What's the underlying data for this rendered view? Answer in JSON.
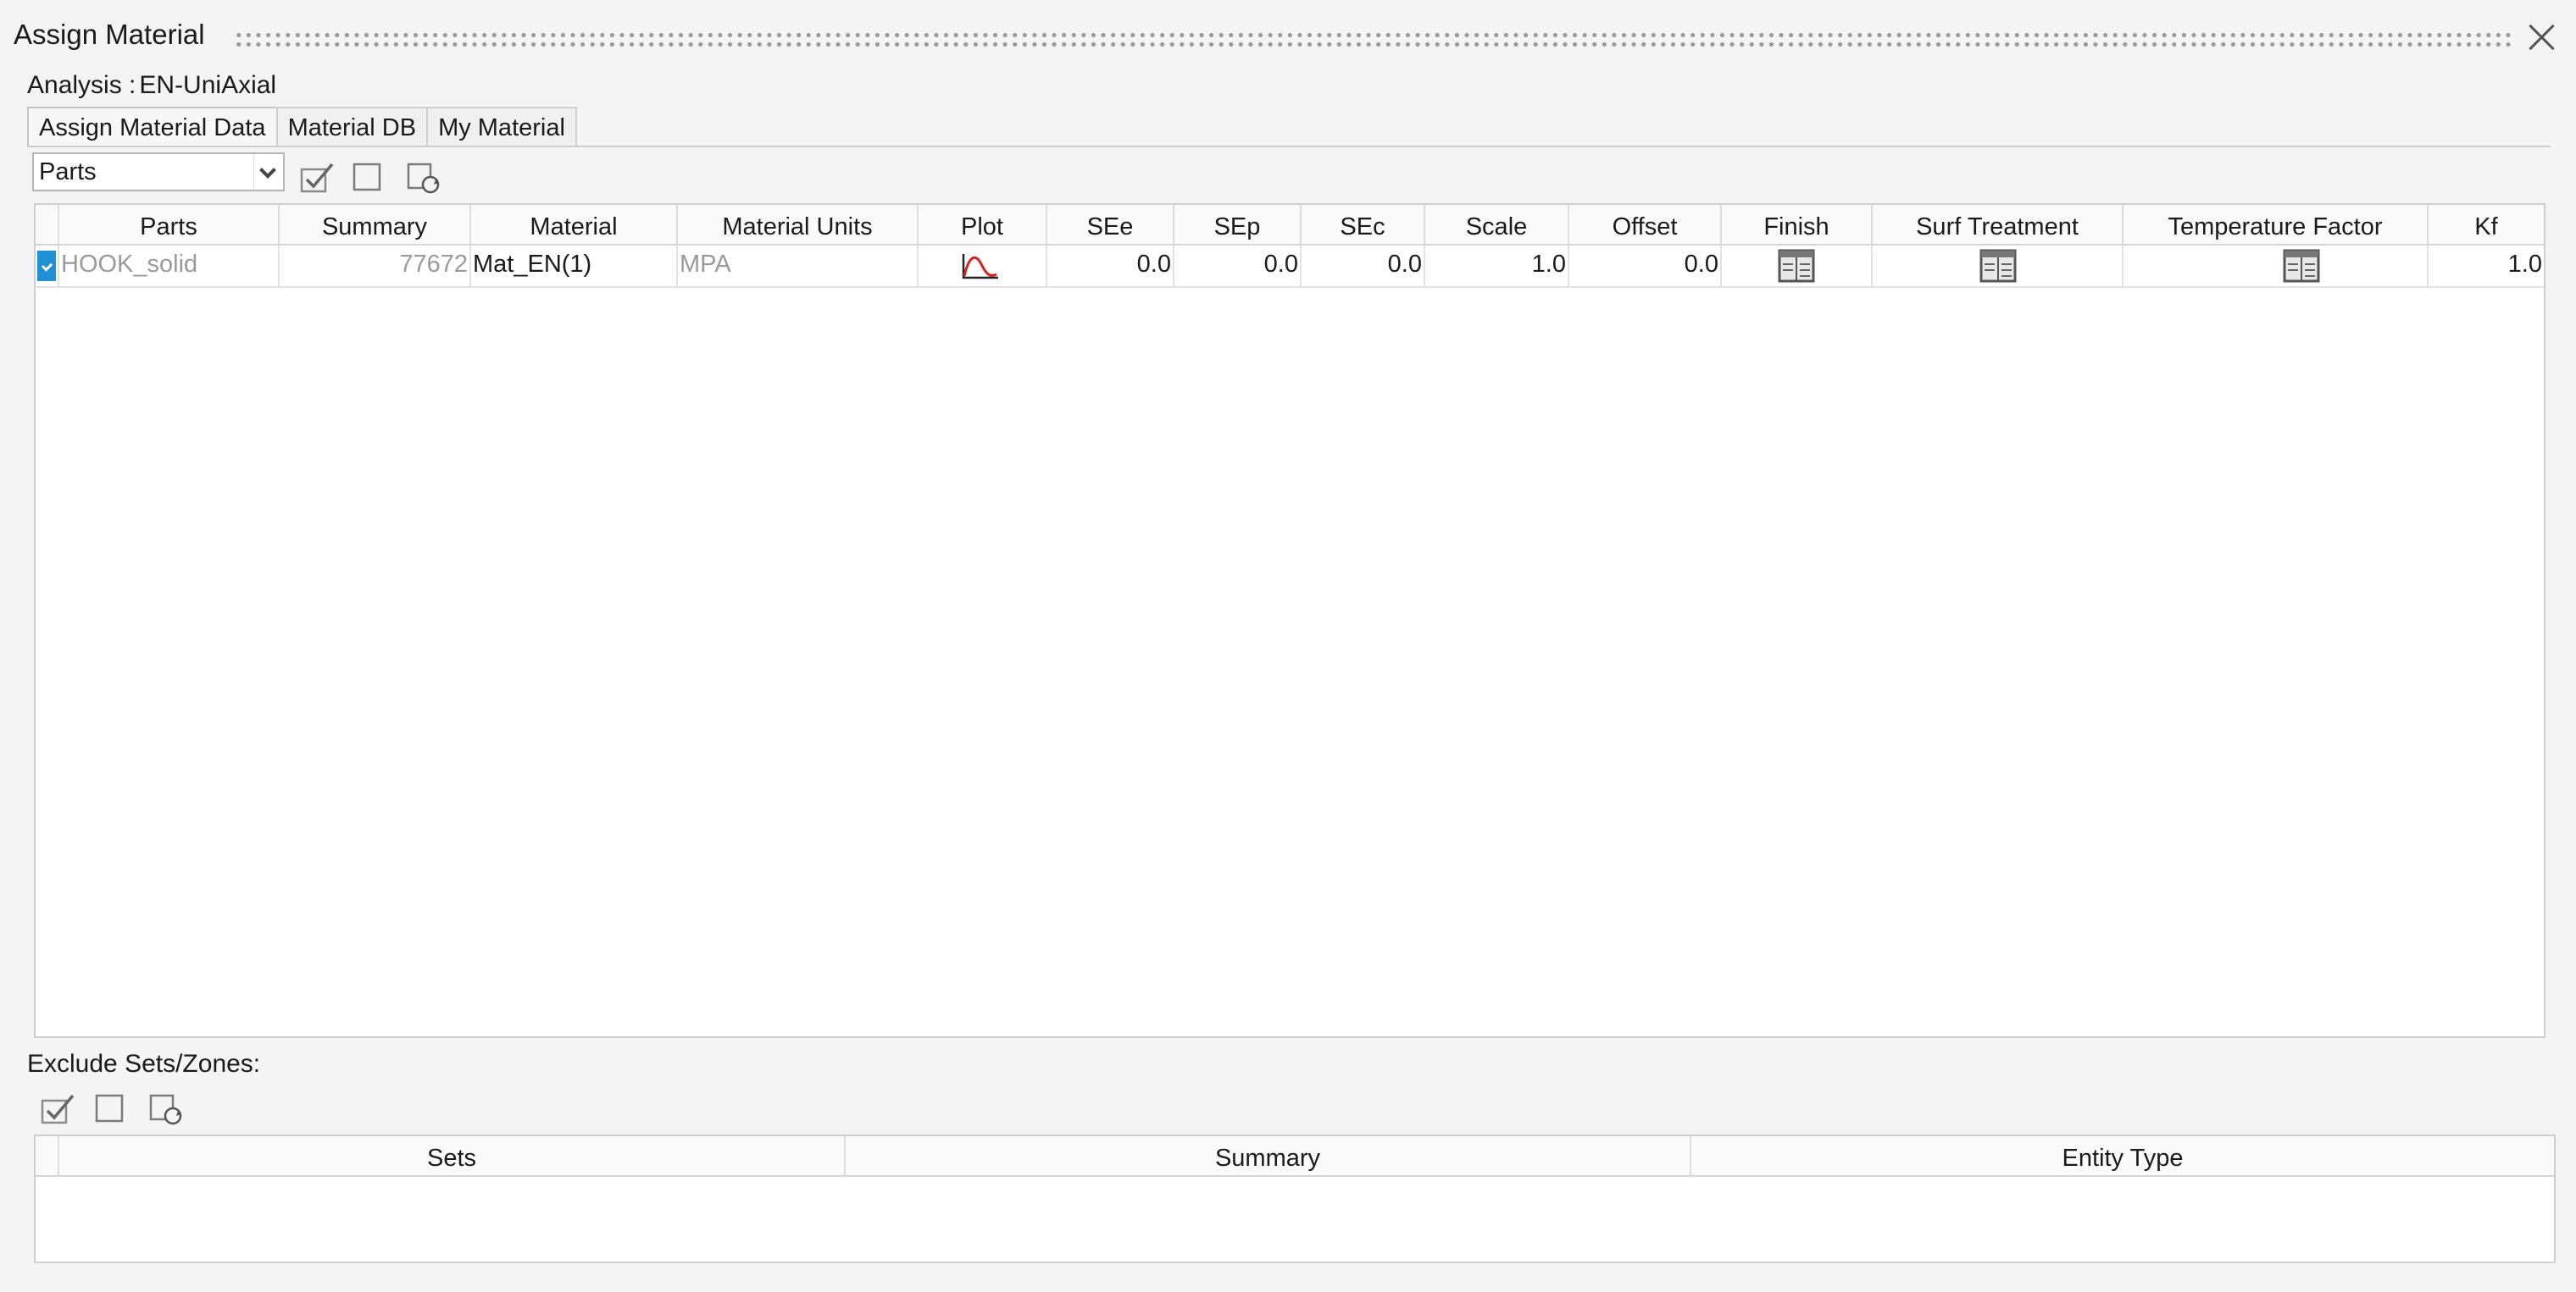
{
  "window": {
    "title": "Assign Material"
  },
  "analysis": {
    "label": "Analysis :",
    "value": "EN-UniAxial"
  },
  "tabs": [
    {
      "label": "Assign Material Data",
      "active": true
    },
    {
      "label": "Material DB",
      "active": false
    },
    {
      "label": "My Material",
      "active": false
    }
  ],
  "toolbar": {
    "selector_value": "Parts",
    "icons": [
      "check-all-icon",
      "uncheck-all-icon",
      "refresh-selection-icon"
    ]
  },
  "parts_table": {
    "columns": [
      "Parts",
      "Summary",
      "Material",
      "Material Units",
      "Plot",
      "SEe",
      "SEp",
      "SEc",
      "Scale",
      "Offset",
      "Finish",
      "Surf Treatment",
      "Temperature Factor",
      "Kf"
    ],
    "rows": [
      {
        "selected": true,
        "part": "HOOK_solid",
        "summary": "77672",
        "material": "Mat_EN(1)",
        "units": "MPA",
        "see": "0.0",
        "sep": "0.0",
        "sec": "0.0",
        "scale": "1.0",
        "offset": "0.0",
        "kf": "1.0"
      }
    ]
  },
  "exclude": {
    "label": "Exclude Sets/Zones:",
    "columns": [
      "Sets",
      "Summary",
      "Entity Type"
    ]
  },
  "colors": {
    "selection": "#1f8fd6",
    "plot_curve": "#d92020"
  }
}
